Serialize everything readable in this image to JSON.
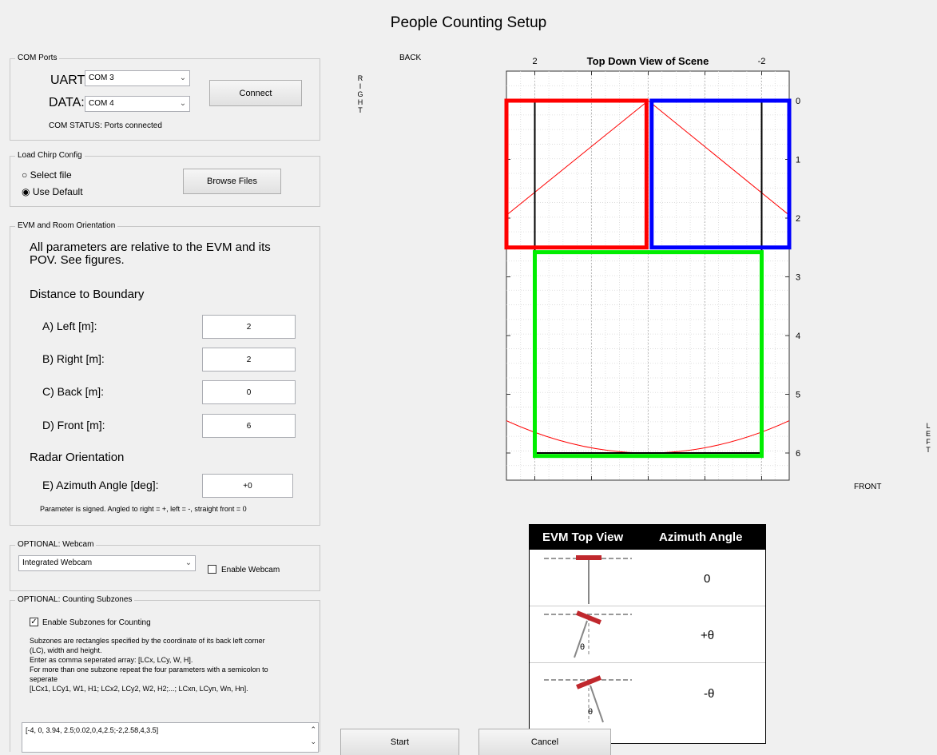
{
  "window": {
    "title": "People Counting Setup"
  },
  "com": {
    "legend": "COM Ports",
    "uart_label": "UART:",
    "uart_value": "COM 3",
    "data_label": "DATA:",
    "data_value": "COM 4",
    "connect_label": "Connect",
    "status": "COM STATUS: Ports connected"
  },
  "chirp": {
    "legend": "Load Chirp Config",
    "select_file": "Select file",
    "use_default": "Use Default",
    "browse_label": "Browse Files"
  },
  "evm": {
    "legend": "EVM and Room Orientation",
    "intro_line1": "All parameters are relative to the EVM and its",
    "intro_line2": "POV.  See figures.",
    "distance_heading": "Distance to Boundary",
    "left_label": "A) Left [m]:",
    "left_value": "2",
    "right_label": "B) Right [m]:",
    "right_value": "2",
    "back_label": "C) Back [m]:",
    "back_value": "0",
    "front_label": "D) Front [m]:",
    "front_value": "6",
    "radar_heading": "Radar Orientation",
    "azimuth_label": "E) Azimuth Angle [deg]:",
    "azimuth_value": "+0",
    "note": "Parameter is signed. Angled to right = +, left = -, straight front = 0"
  },
  "webcam": {
    "legend": "OPTIONAL: Webcam",
    "device": "Integrated Webcam",
    "enable_label": "Enable Webcam",
    "enabled": false
  },
  "subzones": {
    "legend": "OPTIONAL: Counting Subzones",
    "enable_label": "Enable Subzones for Counting",
    "enabled": true,
    "desc1": "Subzones are rectangles specified by the coordinate of its back left corner",
    "desc2": "(LC), width and height.",
    "desc3": "Enter as comma seperated array: [LCx, LCy, W, H].",
    "desc4": "For more than one subzone repeat the four parameters with a semicolon to",
    "desc5": "seperate",
    "desc6": "[LCx1, LCy1, W1, H1; LCx2, LCy2, W2, H2;...; LCxn, LCyn, Wn, Hn].",
    "value": "[-4, 0, 3.94, 2.5;0.02,0,4,2.5;-2,2.58,4,3.5]"
  },
  "plot": {
    "title": "Top Down View of Scene",
    "back_label": "BACK",
    "front_label": "FRONT",
    "right_letters": [
      "R",
      "I",
      "G",
      "H",
      "T"
    ],
    "left_letters": [
      "L",
      "E",
      "F",
      "T"
    ],
    "x_ticks": [
      {
        "label": "2",
        "v": 2
      },
      {
        "label": "-2",
        "v": -2
      }
    ],
    "y_ticks": [
      "0",
      "1",
      "2",
      "3",
      "4",
      "5",
      "6"
    ],
    "colors": {
      "red": "#ff0000",
      "blue": "#0000ff",
      "green": "#00ee00",
      "black": "#000000"
    }
  },
  "angle_table": {
    "col1": "EVM Top View",
    "col2": "Azimuth Angle",
    "rows": [
      {
        "angle": "0",
        "theta_mark": ""
      },
      {
        "angle": "+θ",
        "theta_mark": "θ"
      },
      {
        "angle": "-θ",
        "theta_mark": "θ"
      }
    ]
  },
  "actions": {
    "start_label": "Start",
    "cancel_label": "Cancel"
  }
}
